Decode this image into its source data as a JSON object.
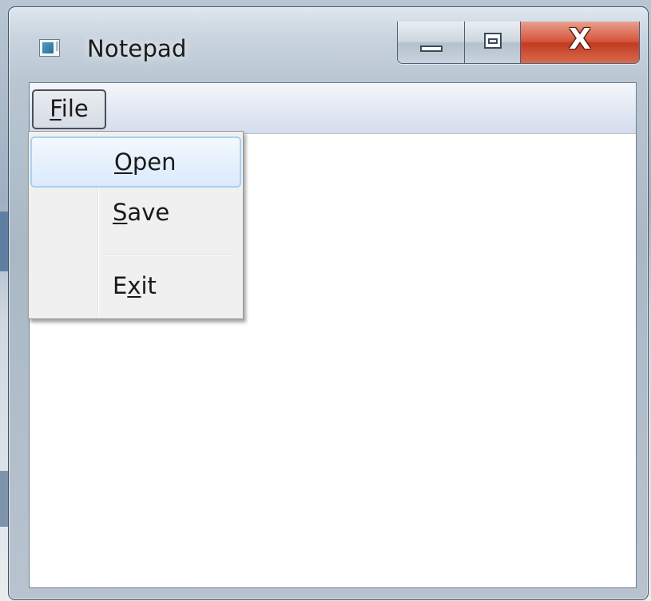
{
  "window": {
    "title": "Notepad",
    "icon": "notepad-app-icon",
    "close_glyph": "X"
  },
  "menubar": {
    "file": {
      "mnemonic": "F",
      "rest": "ile"
    }
  },
  "file_menu": {
    "items": [
      {
        "mnemonic": "O",
        "rest": "pen",
        "state": "highlighted"
      },
      {
        "mnemonic": "S",
        "rest": "ave"
      },
      {
        "before": "E",
        "mnemonic": "x",
        "rest": "it"
      }
    ]
  },
  "colors": {
    "highlight_border": "#a8d0f2",
    "close_button": "#c23a22",
    "menu_background": "#f0f0f0"
  }
}
